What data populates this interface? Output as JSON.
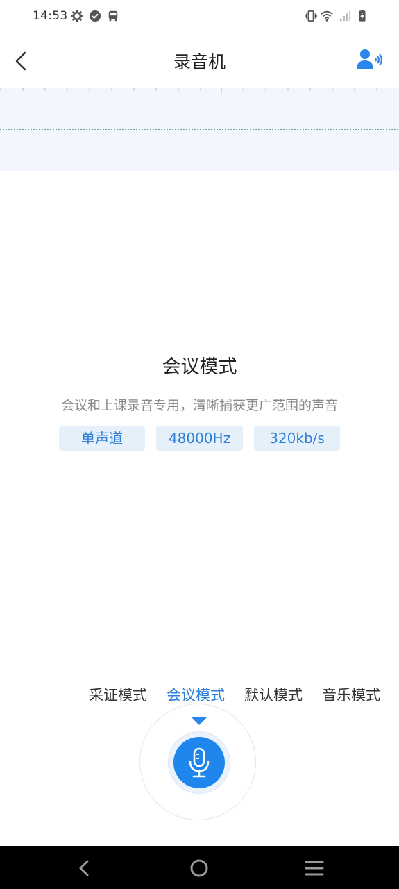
{
  "status": {
    "time": "14:53",
    "icons": [
      "gear-icon",
      "check-circle-icon",
      "bus-icon",
      "vibrate-icon",
      "wifi-icon",
      "signal-icon",
      "battery-charging-icon"
    ]
  },
  "header": {
    "title": "录音机",
    "back_icon": "chevron-left-icon",
    "voice_icon": "person-voice-icon",
    "accent": "#2a86e8"
  },
  "mode_info": {
    "title": "会议模式",
    "description": "会议和上课录音专用，清晰捕获更广范围的声音",
    "tags": [
      "单声道",
      "48000Hz",
      "320kb/s"
    ]
  },
  "modes": {
    "items": [
      "采证模式",
      "会议模式",
      "默认模式",
      "音乐模式"
    ],
    "selected": "会议模式"
  },
  "record": {
    "icon": "microphone-icon",
    "color": "#1f86ee"
  },
  "nav": {
    "icons": [
      "nav-back-icon",
      "nav-home-icon",
      "nav-menu-icon"
    ]
  }
}
